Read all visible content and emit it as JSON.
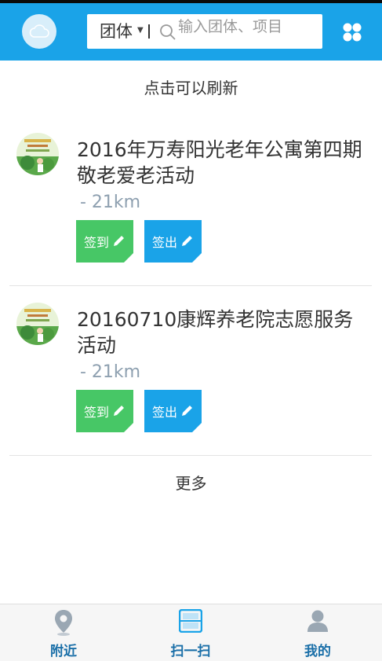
{
  "header": {
    "search_scope": "团体",
    "search_placeholder": "输入团体、项目"
  },
  "refresh_text": "点击可以刷新",
  "events": [
    {
      "title": "2016年万寿阳光老年公寓第四期敬老爱老活动",
      "distance": "- 21km",
      "checkin_label": "签到",
      "checkout_label": "签出"
    },
    {
      "title": "20160710康辉养老院志愿服务活动",
      "distance": "- 21km",
      "checkin_label": "签到",
      "checkout_label": "签出"
    }
  ],
  "more_text": "更多",
  "tabbar": {
    "items": [
      {
        "label": "附近",
        "icon": "location-pin-icon"
      },
      {
        "label": "扫一扫",
        "icon": "scan-icon"
      },
      {
        "label": "我的",
        "icon": "user-icon"
      }
    ]
  },
  "colors": {
    "primary": "#1aa3e8",
    "checkin_green": "#47c766",
    "distance_gray": "#8ea0b0",
    "tab_label": "#1a6fa8"
  }
}
